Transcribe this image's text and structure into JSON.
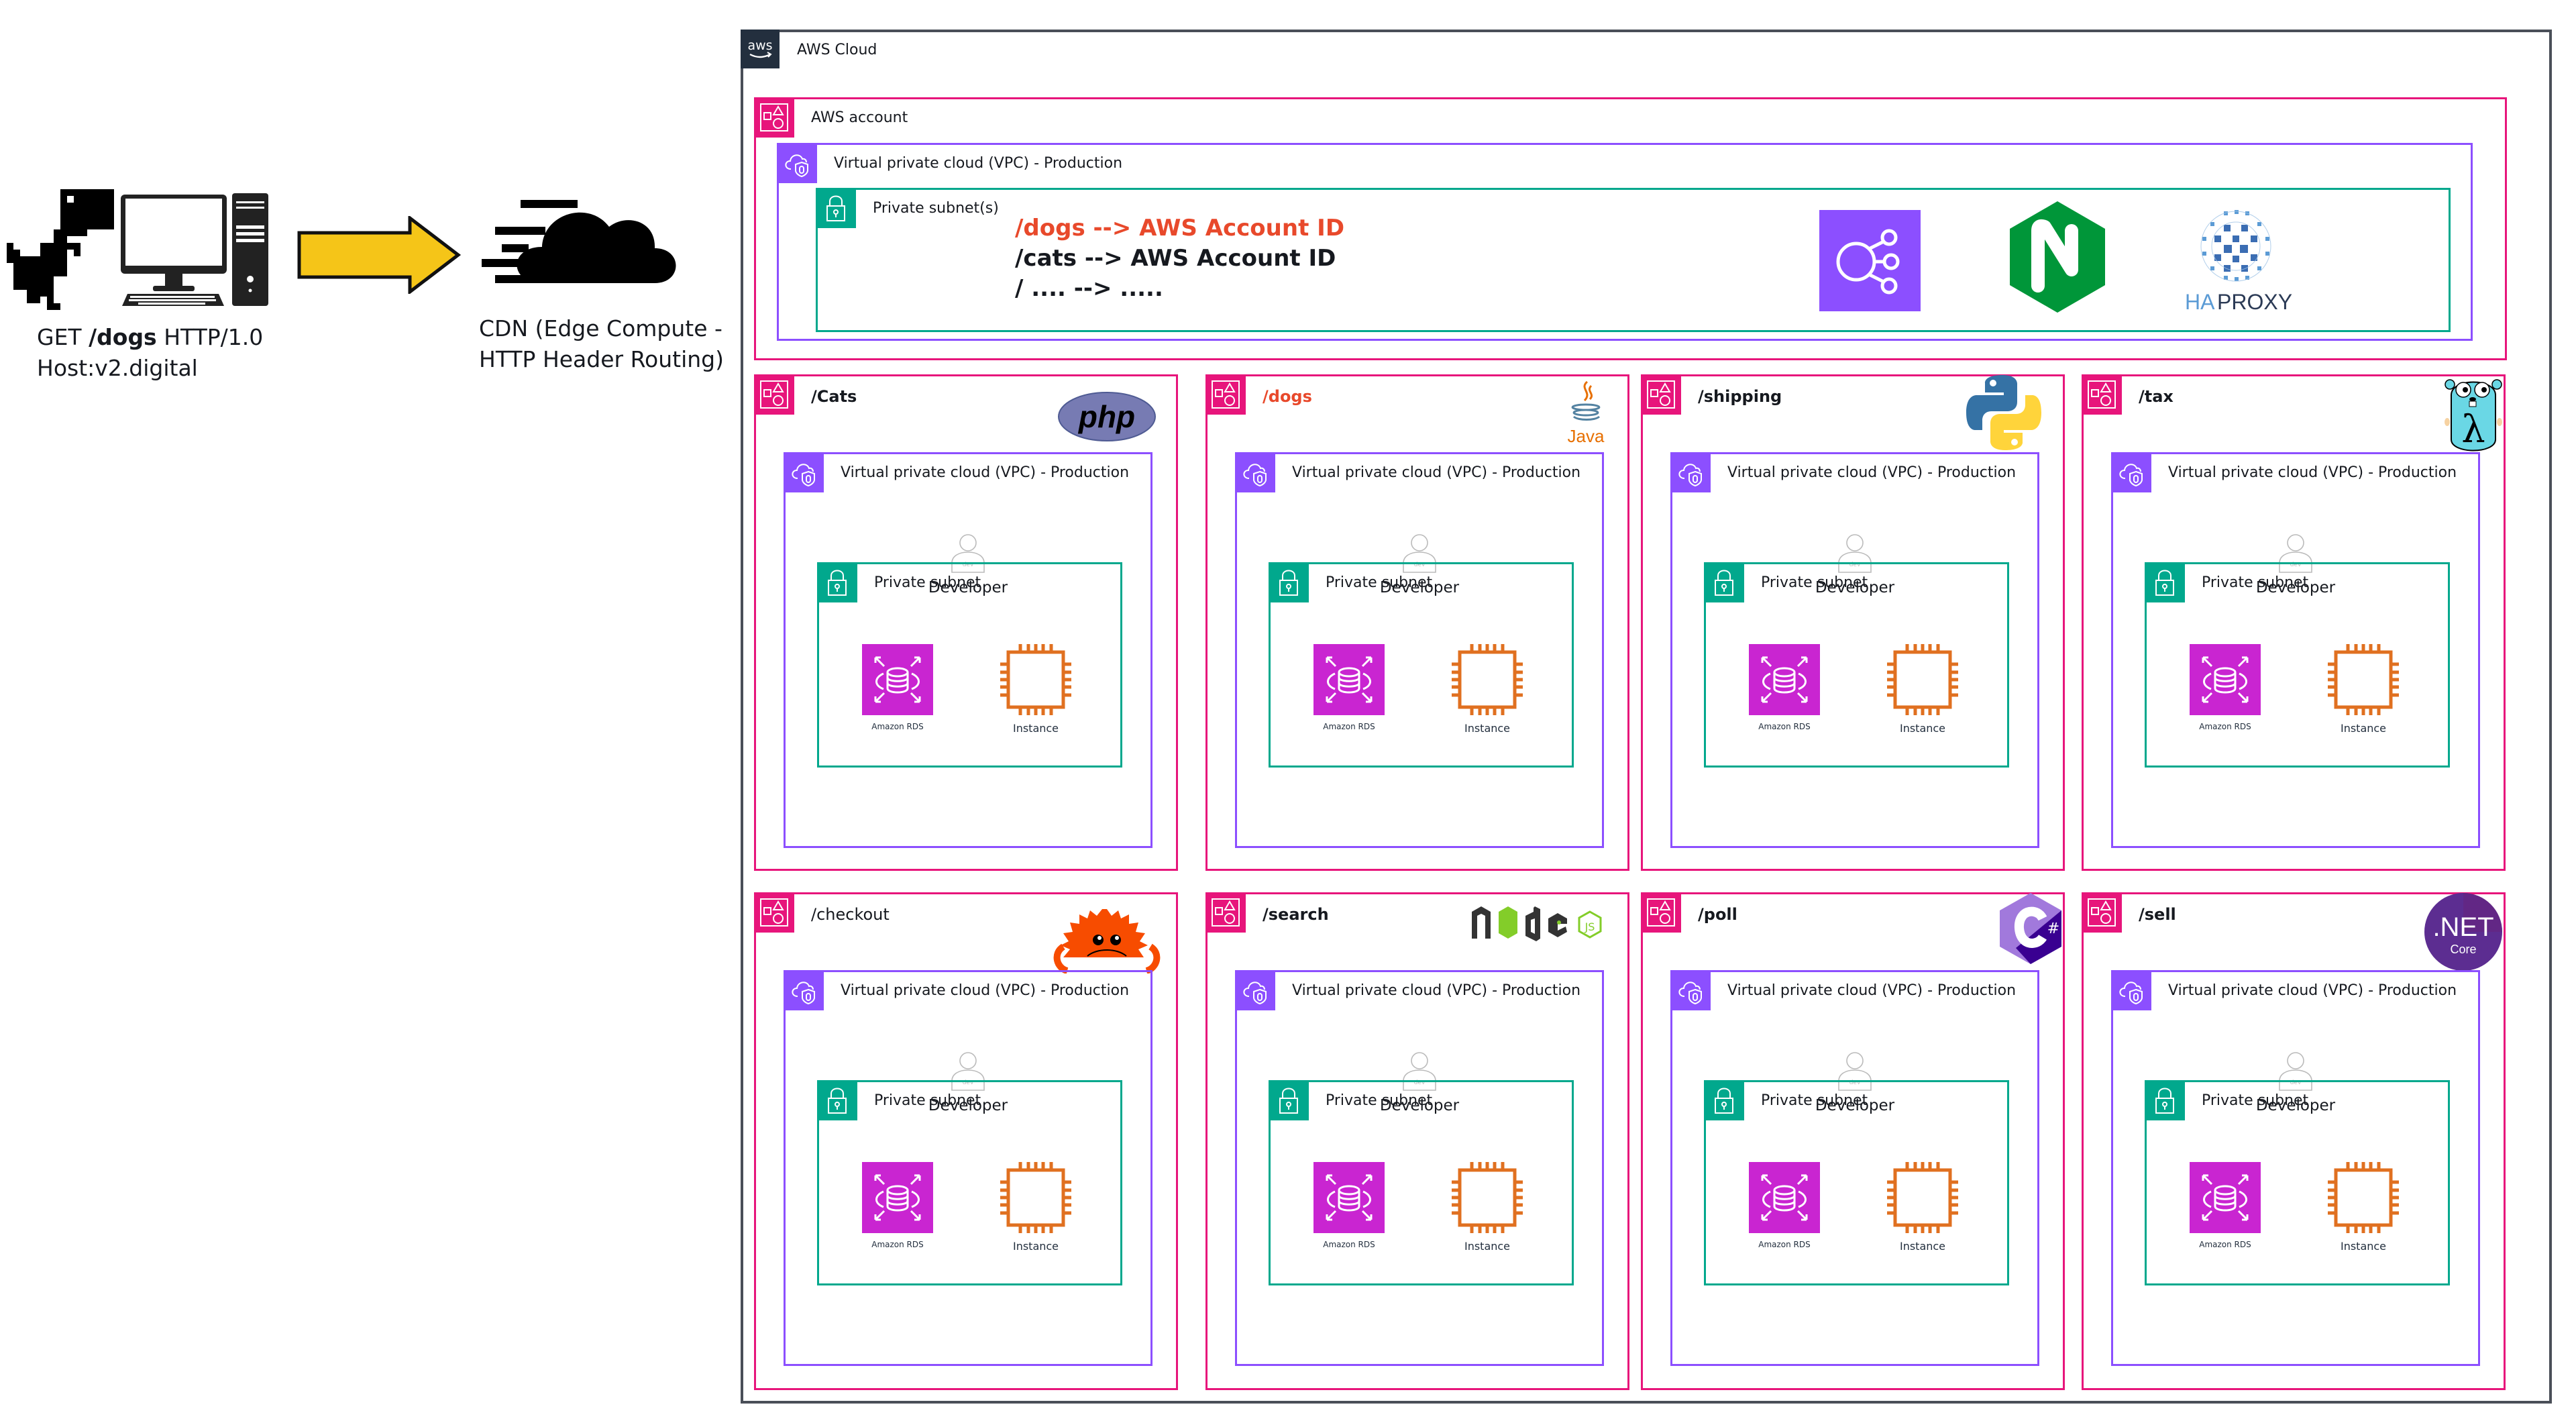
{
  "client": {
    "request_method": "GET",
    "request_path": "/dogs",
    "request_protocol": "HTTP/1.0",
    "host_line": "Host:v2.digital",
    "icons": [
      "dinosaur-icon",
      "desktop-computer-icon"
    ]
  },
  "cdn": {
    "line1": "CDN (Edge Compute -",
    "line2": "HTTP Header Routing)",
    "icon": "fast-cloud-icon"
  },
  "arrow_color": "#f5c518",
  "aws_cloud": {
    "label": "AWS Cloud",
    "logo_text": "aws",
    "account": {
      "label": "AWS account",
      "vpc": {
        "label": "Virtual private cloud (VPC) - Production",
        "subnet": {
          "label": "Private subnet(s)",
          "routes": [
            {
              "text": "/dogs --> AWS Account ID",
              "color": "#e8492b"
            },
            {
              "text": "/cats --> AWS Account ID",
              "color": "#16191f"
            },
            {
              "text": "/ .... --> .....",
              "color": "#16191f"
            }
          ],
          "load_balancers": [
            {
              "name": "elastic-load-balancing",
              "icon": "elb-icon"
            },
            {
              "name": "nginx",
              "icon": "nginx-icon",
              "letter": "N"
            },
            {
              "name": "haproxy",
              "icon": "haproxy-icon",
              "text_ha": "HA",
              "text_proxy": "PROXY"
            }
          ]
        }
      }
    },
    "services": [
      {
        "path": "/Cats",
        "style": "bold",
        "language": "php",
        "logo_text": "php"
      },
      {
        "path": "/dogs",
        "style": "highlight",
        "language": "java",
        "logo_text": "Java"
      },
      {
        "path": "/shipping",
        "style": "bold",
        "language": "python",
        "logo_text": ""
      },
      {
        "path": "/tax",
        "style": "bold",
        "language": "go",
        "logo_text": "λ"
      },
      {
        "path": "/checkout",
        "style": "plain",
        "language": "rust",
        "logo_text": ""
      },
      {
        "path": "/search",
        "style": "bold",
        "language": "nodejs",
        "logo_text": "node"
      },
      {
        "path": "/poll",
        "style": "bold",
        "language": "csharp",
        "logo_text": "#"
      },
      {
        "path": "/sell",
        "style": "bold",
        "language": "dotnet-core",
        "logo_text": ".NET",
        "logo_sub": "Core"
      }
    ],
    "service_template": {
      "vpc_label": "Virtual private cloud (VPC) - Production",
      "developer_label": "Developer",
      "developer_badge": "dev",
      "subnet_label": "Private subnet",
      "rds_label": "Amazon RDS",
      "instance_label": "Instance"
    }
  },
  "colors": {
    "account": "#e7157b",
    "vpc": "#8c4fff",
    "subnet": "#01a88d",
    "rds": "#c925d1",
    "instance": "#e07020",
    "highlight": "#e8492b"
  }
}
